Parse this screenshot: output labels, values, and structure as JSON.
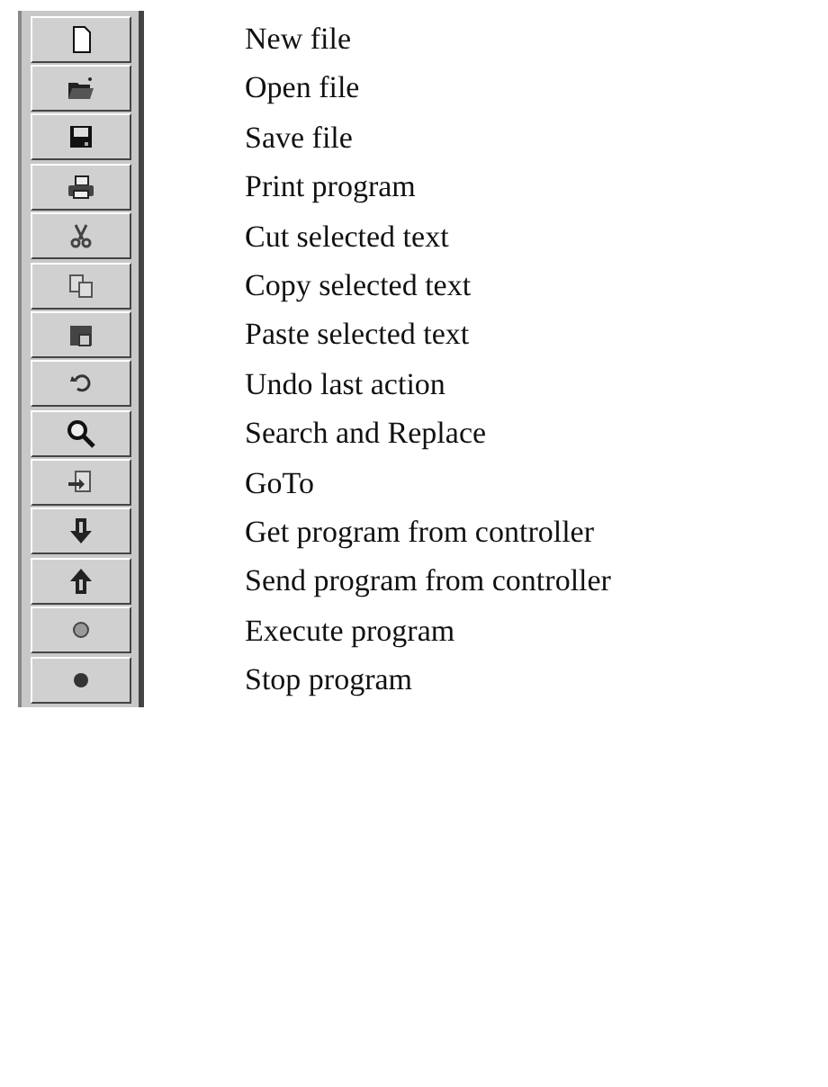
{
  "toolbar": {
    "items": [
      {
        "kind": "new",
        "label": "New file"
      },
      {
        "kind": "open",
        "label": "Open file"
      },
      {
        "kind": "save",
        "label": "Save file"
      },
      {
        "kind": "print",
        "label": "Print program"
      },
      {
        "kind": "cut",
        "label": "Cut selected text"
      },
      {
        "kind": "copy",
        "label": "Copy selected text"
      },
      {
        "kind": "paste",
        "label": "Paste selected text"
      },
      {
        "kind": "undo",
        "label": "Undo last action"
      },
      {
        "kind": "search",
        "label": "Search and Replace"
      },
      {
        "kind": "goto",
        "label": "GoTo"
      },
      {
        "kind": "get",
        "label": "Get program from controller"
      },
      {
        "kind": "send",
        "label": "Send program from controller"
      },
      {
        "kind": "execute",
        "label": "Execute program"
      },
      {
        "kind": "stop",
        "label": "Stop program"
      }
    ]
  }
}
